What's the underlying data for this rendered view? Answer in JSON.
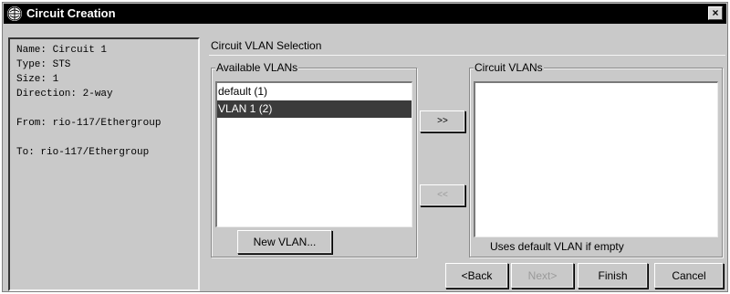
{
  "window": {
    "title": "Circuit Creation",
    "close_label": "×"
  },
  "info": {
    "lines": [
      "Name: Circuit 1",
      "Type: STS",
      "Size: 1",
      "Direction: 2-way",
      "",
      "From: rio-117/Ethergroup",
      "",
      "To: rio-117/Ethergroup"
    ]
  },
  "section": {
    "title": "Circuit VLAN Selection"
  },
  "available": {
    "label": "Available VLANs",
    "items": [
      "default (1)",
      "VLAN 1 (2)"
    ],
    "selected_index": 1,
    "new_button": "New VLAN..."
  },
  "move": {
    "add_label": ">>",
    "remove_label": "<<"
  },
  "circuit": {
    "label": "Circuit VLANs",
    "items": [],
    "hint": "Uses default VLAN if empty"
  },
  "wizard": {
    "back_label": "<Back",
    "next_label": "Next>",
    "finish_label": "Finish",
    "cancel_label": "Cancel"
  }
}
